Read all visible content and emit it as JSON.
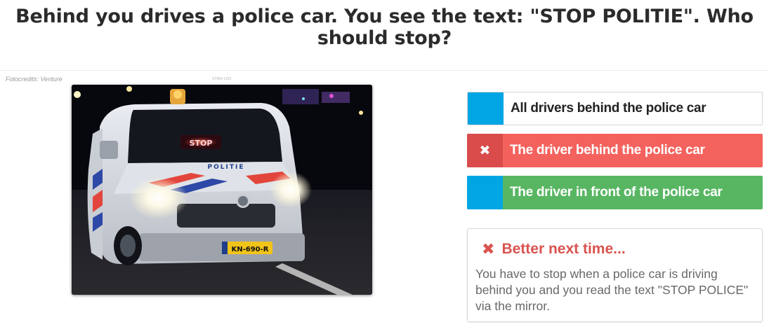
{
  "question": {
    "text": "Behind you drives a police car. You see the text: \"STOP POLITIE\". Who should stop?"
  },
  "photo": {
    "credits": "Fotocredits: Venture",
    "code": "ST904 1225",
    "subject": "police-van-photo",
    "sign_text": "STOP",
    "sign_sub": "POLITIE",
    "hood_text": "POLITIE",
    "plate_text": "KN-690-R"
  },
  "answers": [
    {
      "label": "All drivers behind the police car",
      "state": "neutral",
      "marker": ""
    },
    {
      "label": "The driver behind the police car",
      "state": "wrong",
      "marker": "✖"
    },
    {
      "label": "The driver in front of the police car",
      "state": "correct",
      "marker": ""
    }
  ],
  "feedback": {
    "icon": "✖",
    "title": "Better next time...",
    "body": "You have to stop when a police car is driving behind you and you read the text \"STOP POLICE\" via the mirror."
  },
  "colors": {
    "blue": "#00a6e4",
    "wrong": "#f4625d",
    "wrong_marker": "#d94c4b",
    "correct": "#58b662",
    "feedback_title": "#d9534f"
  }
}
